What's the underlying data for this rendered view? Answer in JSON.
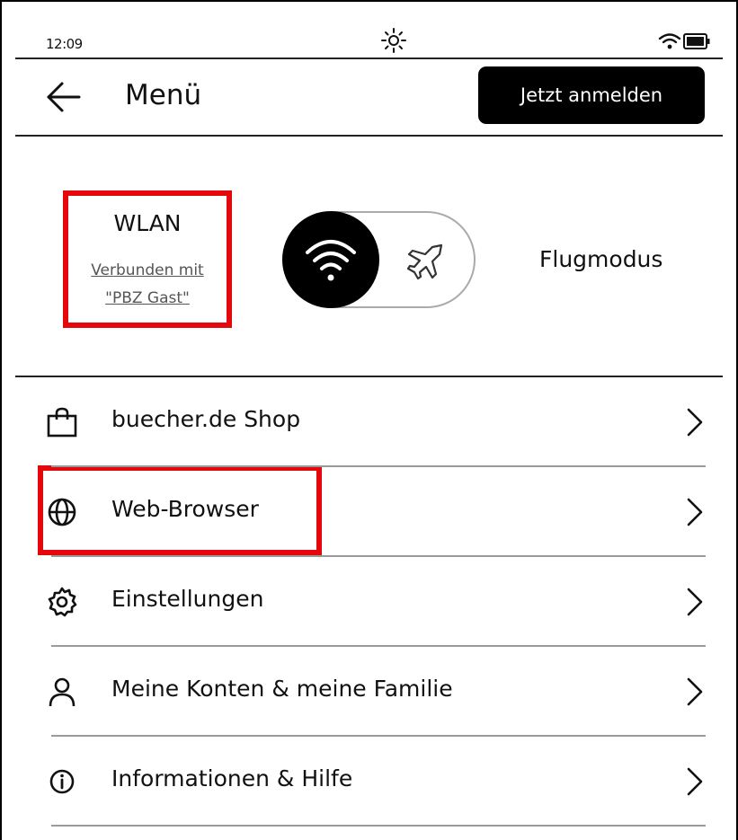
{
  "status": {
    "time": "12:09",
    "icons": [
      "brightness-icon",
      "wifi-icon",
      "battery-icon"
    ]
  },
  "header": {
    "title": "Menü",
    "login_label": "Jetzt anmelden"
  },
  "connectivity": {
    "wlan_label": "WLAN",
    "wlan_status_line1": "Verbunden mit",
    "wlan_status_line2": "\"PBZ Gast\"",
    "airplane_label": "Flugmodus",
    "toggle_state": "wlan"
  },
  "menu": {
    "items": [
      {
        "label": "buecher.de Shop",
        "icon": "shopping-bag-icon"
      },
      {
        "label": "Web-Browser",
        "icon": "globe-icon"
      },
      {
        "label": "Einstellungen",
        "icon": "gear-icon"
      },
      {
        "label": "Meine Konten & meine Familie",
        "icon": "person-icon"
      },
      {
        "label": "Informationen & Hilfe",
        "icon": "info-icon"
      }
    ]
  },
  "colors": {
    "highlight": "#e4070c",
    "button_bg": "#000000",
    "divider": "#9a9a9a"
  }
}
